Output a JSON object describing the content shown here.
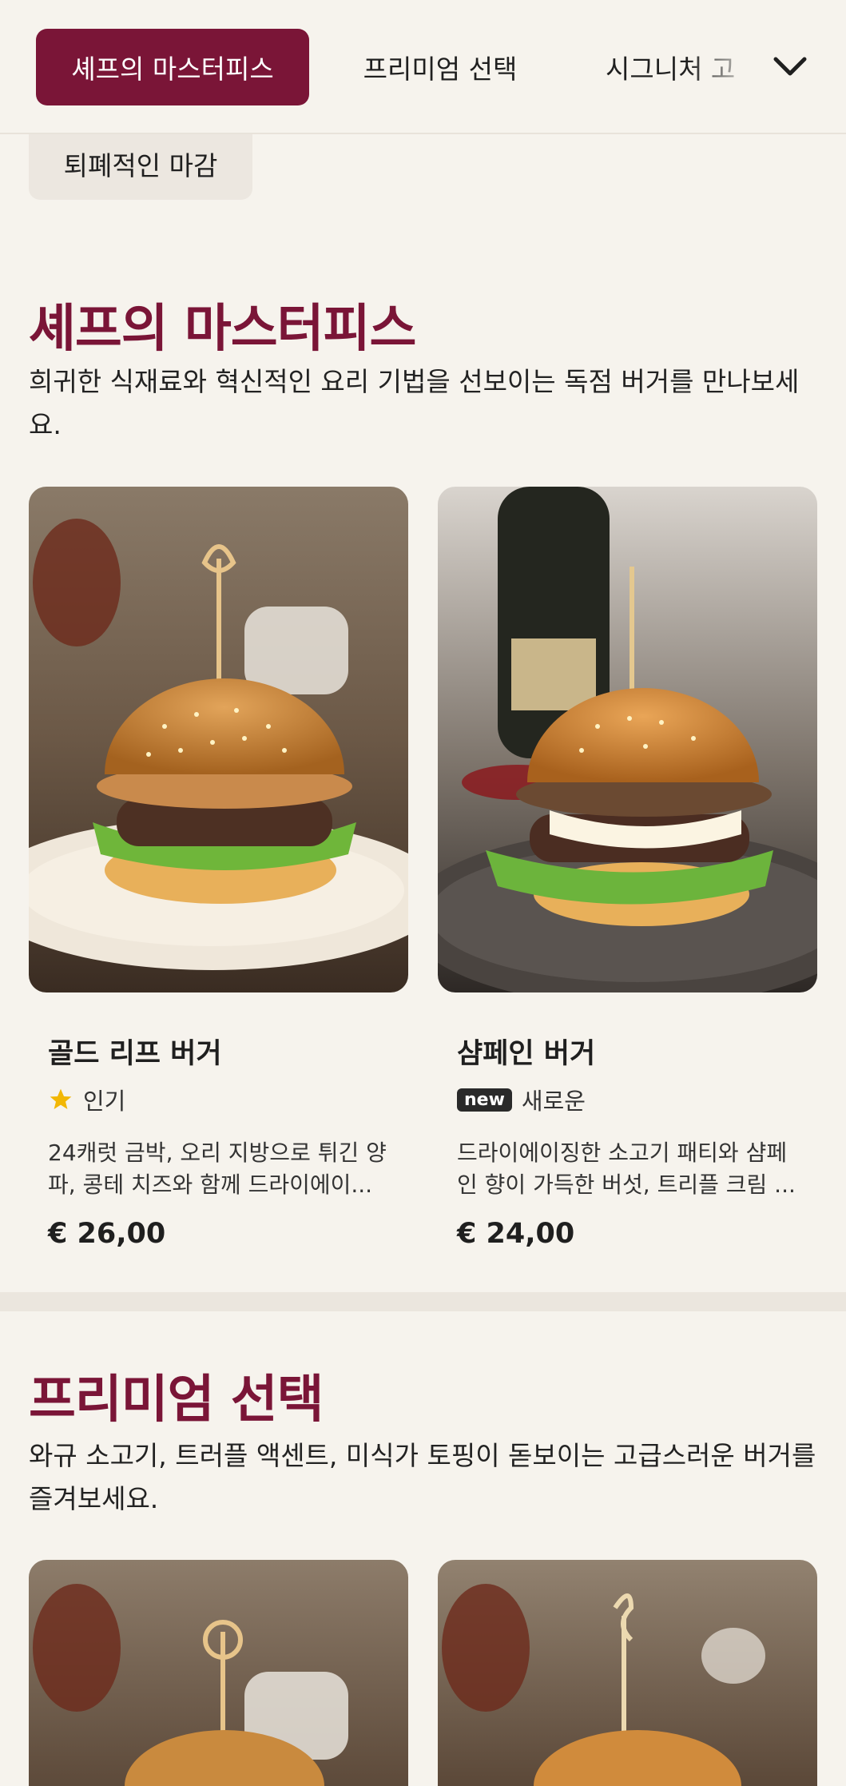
{
  "nav": {
    "tabs": [
      {
        "label": "셰프의 마스터피스"
      },
      {
        "label": "프리미엄 선택"
      },
      {
        "label": "시그니처 고"
      }
    ]
  },
  "filter_pill": {
    "label": "퇴폐적인 마감"
  },
  "sections": [
    {
      "title": "셰프의 마스터피스",
      "description": "희귀한 식재료와 혁신적인 요리 기법을 선보이는 독점 버거를 만나보세요.",
      "items": [
        {
          "name": "골드 리프 버거",
          "badge_label": "인기",
          "badge_icon": "star-icon",
          "description": "24캐럿 금박, 오리 지방으로 튀긴 양파, 콩테 치즈와 함께 드라이에이...",
          "price": "€ 26,00"
        },
        {
          "name": "샴페인 버거",
          "badge_tag": "new",
          "badge_label": "새로운",
          "description": "드라이에이징한 소고기 패티와 샴페인 향이 가득한 버섯, 트리플 크림 ...",
          "price": "€ 24,00"
        }
      ]
    },
    {
      "title": "프리미엄 선택",
      "description": "와규 소고기, 트러플 액센트, 미식가 토핑이 돋보이는 고급스러운 버거를 즐겨보세요."
    }
  ],
  "colors": {
    "accent": "#7a1537",
    "background": "#f6f3ed",
    "star": "#f2b705"
  }
}
